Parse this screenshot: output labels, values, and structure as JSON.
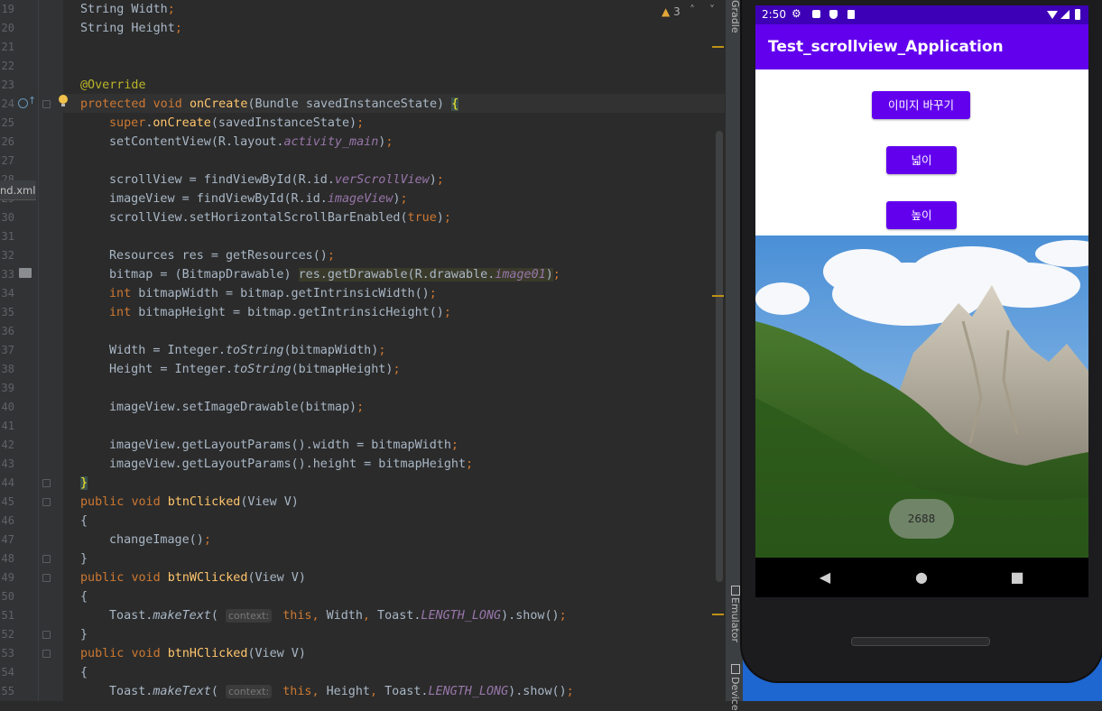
{
  "editor": {
    "file_tab": "nd.xml",
    "warnings": {
      "icon": "warning-triangle-icon",
      "count": "3"
    },
    "lines": [
      {
        "n": "19",
        "text": "String Width;"
      },
      {
        "n": "20",
        "text": "String Height;"
      },
      {
        "n": "21",
        "text": ""
      },
      {
        "n": "22",
        "text": ""
      },
      {
        "n": "23",
        "text": "@Override"
      },
      {
        "n": "24",
        "text": "protected void onCreate(Bundle savedInstanceState) {"
      },
      {
        "n": "25",
        "text": "super.onCreate(savedInstanceState);"
      },
      {
        "n": "26",
        "text": "setContentView(R.layout.activity_main);"
      },
      {
        "n": "27",
        "text": ""
      },
      {
        "n": "28",
        "text": "scrollView = findViewById(R.id.verScrollView);"
      },
      {
        "n": "29",
        "text": "imageView = findViewById(R.id.imageView);"
      },
      {
        "n": "30",
        "text": "scrollView.setHorizontalScrollBarEnabled(true);"
      },
      {
        "n": "31",
        "text": ""
      },
      {
        "n": "32",
        "text": "Resources res = getResources();"
      },
      {
        "n": "33",
        "text": "bitmap = (BitmapDrawable) res.getDrawable(R.drawable.image01);"
      },
      {
        "n": "34",
        "text": "int bitmapWidth = bitmap.getIntrinsicWidth();"
      },
      {
        "n": "35",
        "text": "int bitmapHeight = bitmap.getIntrinsicHeight();"
      },
      {
        "n": "36",
        "text": ""
      },
      {
        "n": "37",
        "text": "Width = Integer.toString(bitmapWidth);"
      },
      {
        "n": "38",
        "text": "Height = Integer.toString(bitmapHeight);"
      },
      {
        "n": "39",
        "text": ""
      },
      {
        "n": "40",
        "text": "imageView.setImageDrawable(bitmap);"
      },
      {
        "n": "41",
        "text": ""
      },
      {
        "n": "42",
        "text": "imageView.getLayoutParams().width = bitmapWidth;"
      },
      {
        "n": "43",
        "text": "imageView.getLayoutParams().height = bitmapHeight;"
      },
      {
        "n": "44",
        "text": "}"
      },
      {
        "n": "45",
        "text": "public void btnClicked(View V)"
      },
      {
        "n": "46",
        "text": "{"
      },
      {
        "n": "47",
        "text": "changeImage();"
      },
      {
        "n": "48",
        "text": "}"
      },
      {
        "n": "49",
        "text": "public void btnWClicked(View V)"
      },
      {
        "n": "50",
        "text": "{"
      },
      {
        "n": "51",
        "text": "Toast.makeText( context: this, Width, Toast.LENGTH_LONG).show();"
      },
      {
        "n": "52",
        "text": "}"
      },
      {
        "n": "53",
        "text": "public void btnHClicked(View V)"
      },
      {
        "n": "54",
        "text": "{"
      },
      {
        "n": "55",
        "text": "Toast.makeText( context: this, Height, Toast.LENGTH_LONG).show();"
      }
    ]
  },
  "toolstrip": {
    "gradle": "Gradle",
    "emulator": "Emulator",
    "device": "Device"
  },
  "emulator": {
    "status_time": "2:50",
    "app_title": "Test_scrollview_Application",
    "buttons": {
      "change_image": "이미지 바꾸기",
      "width": "넓이",
      "height": "높이"
    },
    "toast_text": "2688",
    "colors": {
      "primary": "#6200ee",
      "status_bar": "#3d00b7"
    }
  }
}
